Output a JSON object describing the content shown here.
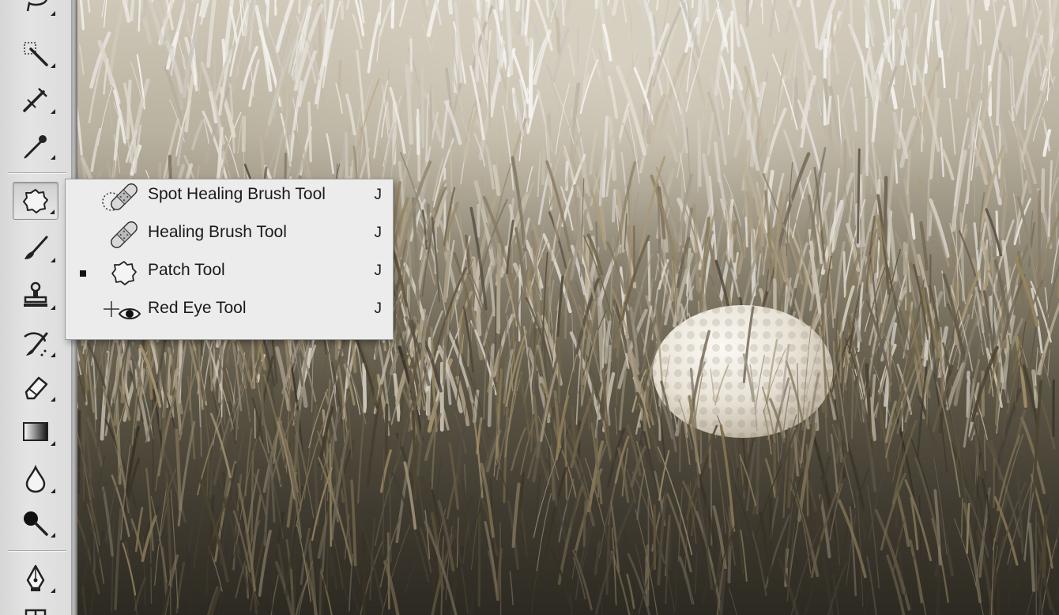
{
  "toolbar": {
    "tools": [
      {
        "icon": "lasso-icon",
        "active": false
      },
      {
        "icon": "quick-selection-icon",
        "active": false
      },
      {
        "icon": "crop-slice-icon",
        "active": false
      },
      {
        "icon": "eyedropper-icon",
        "active": false
      },
      {
        "icon": "patch-icon",
        "active": true
      },
      {
        "icon": "brush-icon",
        "active": false
      },
      {
        "icon": "clone-stamp-icon",
        "active": false
      },
      {
        "icon": "history-brush-icon",
        "active": false
      },
      {
        "icon": "eraser-icon",
        "active": false
      },
      {
        "icon": "gradient-icon",
        "active": false
      },
      {
        "icon": "blur-drop-icon",
        "active": false
      },
      {
        "icon": "dodge-icon",
        "active": false
      },
      {
        "icon": "pen-icon",
        "active": false
      },
      {
        "icon": "type-icon",
        "active": false
      }
    ]
  },
  "flyout": {
    "items": [
      {
        "label": "Spot Healing Brush Tool",
        "shortcut": "J",
        "icon": "spot-healing-brush-icon",
        "selected": false
      },
      {
        "label": "Healing Brush Tool",
        "shortcut": "J",
        "icon": "healing-brush-icon",
        "selected": false
      },
      {
        "label": "Patch Tool",
        "shortcut": "J",
        "icon": "patch-icon",
        "selected": true
      },
      {
        "label": "Red Eye Tool",
        "shortcut": "J",
        "icon": "red-eye-icon",
        "selected": false
      }
    ]
  },
  "canvas": {
    "subject": "golf-ball-in-grass",
    "tone": "#b8ad97"
  }
}
